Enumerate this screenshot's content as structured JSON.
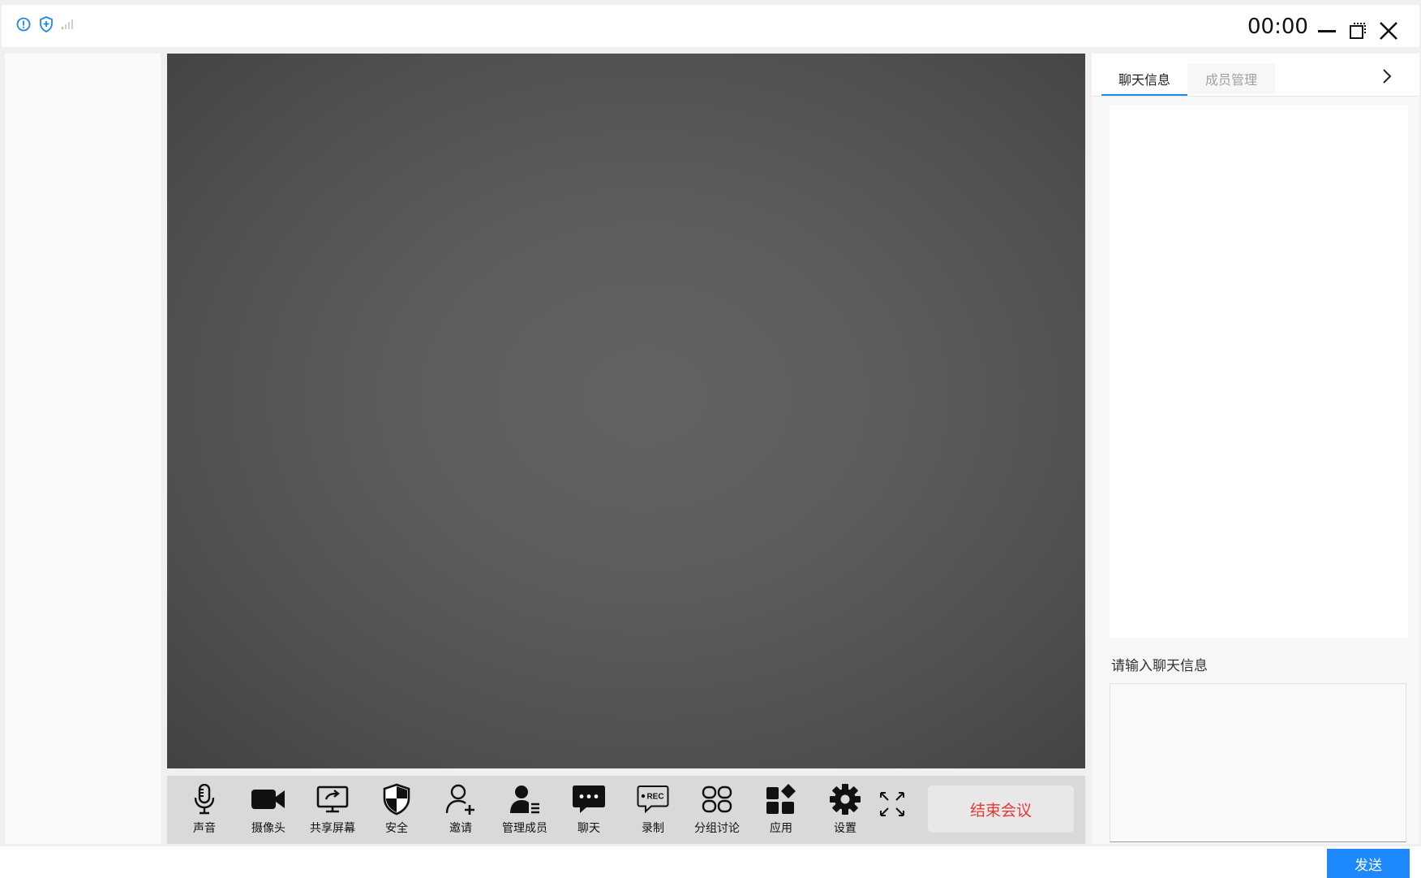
{
  "titlebar": {
    "timer": "00:00",
    "left_icons": [
      "info-icon",
      "shield-icon",
      "signal-icon"
    ],
    "window_controls": [
      "minimize-icon",
      "restore-icon",
      "close-icon"
    ]
  },
  "toolbar": {
    "items": [
      {
        "label": "声音",
        "icon": "microphone-icon"
      },
      {
        "label": "摄像头",
        "icon": "camera-icon"
      },
      {
        "label": "共享屏幕",
        "icon": "share-screen-icon"
      },
      {
        "label": "安全",
        "icon": "security-shield-icon"
      },
      {
        "label": "邀请",
        "icon": "invite-user-icon"
      },
      {
        "label": "管理成员",
        "icon": "manage-members-icon"
      },
      {
        "label": "聊天",
        "icon": "chat-bubble-icon"
      },
      {
        "label": "录制",
        "icon": "record-icon"
      },
      {
        "label": "分组讨论",
        "icon": "breakout-rooms-icon"
      },
      {
        "label": "应用",
        "icon": "apps-icon"
      },
      {
        "label": "设置",
        "icon": "gear-icon"
      }
    ],
    "fullscreen_icon": "fullscreen-icon",
    "end_meeting_label": "结束会议",
    "rec_badge": "REC"
  },
  "right_panel": {
    "tabs": [
      {
        "label": "聊天信息",
        "active": true
      },
      {
        "label": "成员管理",
        "active": false
      }
    ],
    "input_label": "请输入聊天信息",
    "send_label": "发送"
  },
  "colors": {
    "accent": "#1e88ff",
    "end_meeting_text": "#e53935",
    "titlebar_icon": "#1e88e5"
  }
}
